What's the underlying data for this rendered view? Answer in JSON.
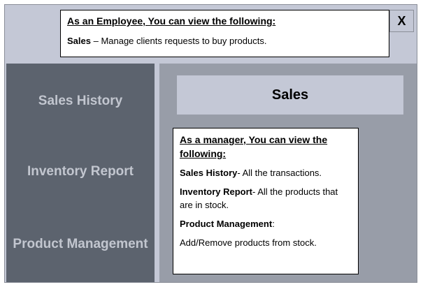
{
  "employee_box": {
    "heading": "As an Employee, You can view the following:",
    "sales_term": "Sales",
    "sales_desc": " – Manage clients requests to buy products."
  },
  "close_label": "X",
  "sidebar": {
    "items": [
      {
        "label": "Sales History"
      },
      {
        "label": "Inventory Report"
      },
      {
        "label": "Product Management"
      }
    ]
  },
  "main": {
    "sales_button_label": "Sales"
  },
  "manager_box": {
    "heading": "As a manager, You can view the following:",
    "entries": [
      {
        "term": "Sales History",
        "desc": "- All the transactions."
      },
      {
        "term": "Inventory Report",
        "desc": "- All the products that are in stock."
      },
      {
        "term": "Product Management",
        "desc": ":"
      }
    ],
    "last_line": "Add/Remove products from stock."
  },
  "colors": {
    "frame": "#c4c8d6",
    "sidebar": "#5c636e",
    "sidebar_text": "#c2c6cf",
    "main_panel": "#989da8"
  }
}
